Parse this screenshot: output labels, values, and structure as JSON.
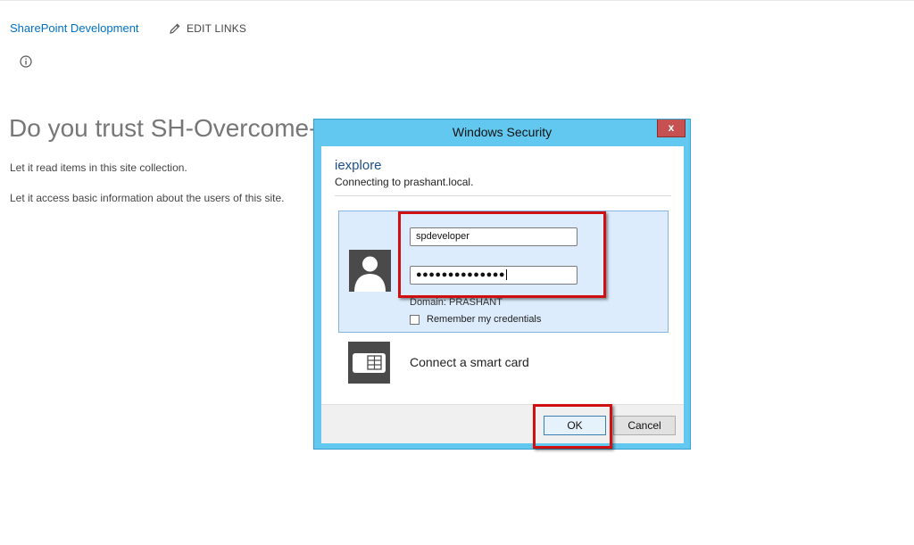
{
  "site": {
    "name_link": "SharePoint Development",
    "edit_links_label": "EDIT LINKS"
  },
  "trust": {
    "title": "Do you trust SH-Overcome-",
    "permissions": [
      "Let it read items in this site collection.",
      "Let it access basic information about the users of this site."
    ]
  },
  "dialog": {
    "title": "Windows Security",
    "close_label": "x",
    "app_name": "iexplore",
    "connecting_text": "Connecting to prashant.local.",
    "username_value": "spdeveloper",
    "password_mask": "●●●●●●●●●●●●●●",
    "domain_text": "Domain: PRASHANT",
    "remember_label": "Remember my credentials",
    "smartcard_label": "Connect a smart card",
    "ok_label": "OK",
    "cancel_label": "Cancel"
  },
  "icons": {
    "edit": "pencil-icon",
    "info": "info-icon",
    "user": "user-icon",
    "smartcard": "smart-card-icon"
  },
  "colors": {
    "link": "#0072c6",
    "dialog_frame": "#62c8ef",
    "close_button": "#c75050",
    "credential_panel": "#dcecfc",
    "highlight": "#d01010"
  }
}
